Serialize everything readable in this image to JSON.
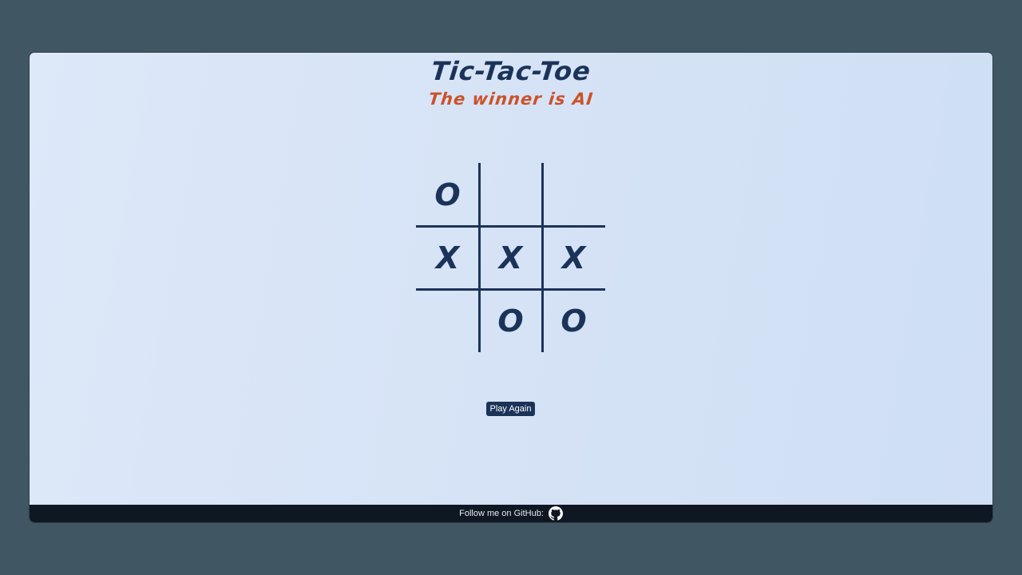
{
  "header": {
    "title": "Tic-Tac-Toe",
    "status": "The winner is AI"
  },
  "board": {
    "cells": [
      "O",
      "",
      "",
      "X",
      "X",
      "X",
      "",
      "O",
      "O"
    ]
  },
  "actions": {
    "play_again_label": "Play Again"
  },
  "footer": {
    "text": "Follow me on GitHub:",
    "icon": "github-icon"
  },
  "colors": {
    "background": "#405663",
    "ink": "#1c3359",
    "status": "#cc5228",
    "footer": "#0f1722"
  }
}
